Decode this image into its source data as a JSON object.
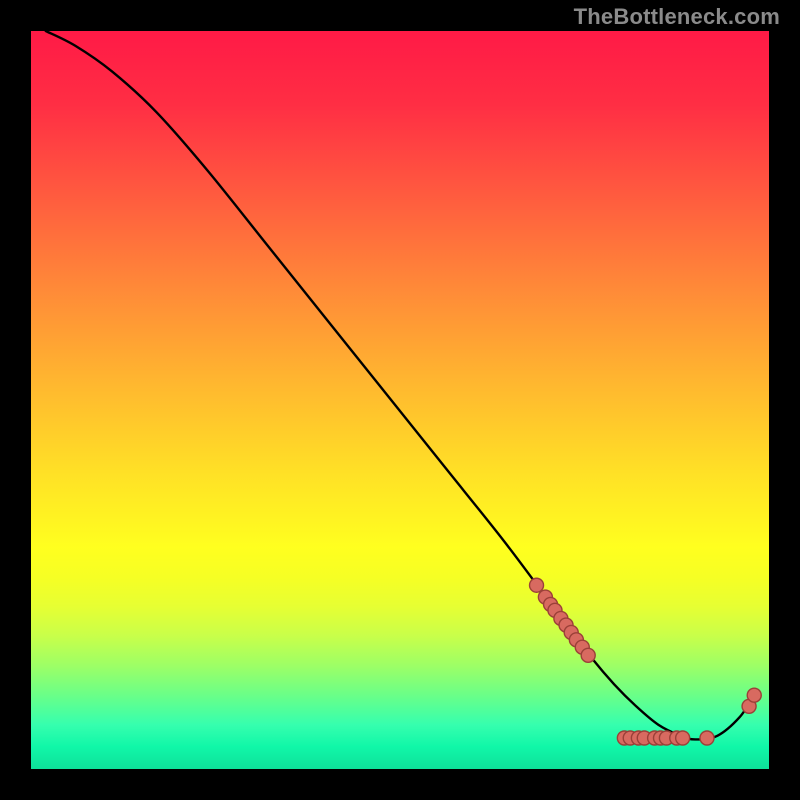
{
  "watermark": "TheBottleneck.com",
  "chart_data": {
    "type": "line",
    "title": "",
    "xlabel": "",
    "ylabel": "",
    "xlim": [
      0,
      100
    ],
    "ylim": [
      0,
      100
    ],
    "grid": false,
    "legend": false,
    "note": "Axes are implicit (no ticks shown). x is horizontal position 0–100, y is vertical value 0–100 with 0 at bottom.",
    "series": [
      {
        "name": "curve",
        "type": "line",
        "color": "#000000",
        "x": [
          2,
          6,
          11,
          17,
          24,
          32,
          40,
          48,
          56,
          64,
          70,
          73,
          76,
          79,
          82,
          85,
          88,
          90,
          93,
          96,
          98
        ],
        "y": [
          100,
          98,
          94.5,
          89,
          81,
          71,
          61,
          51,
          41,
          31,
          23,
          19,
          15,
          11.5,
          8.5,
          6,
          4.5,
          4,
          4.5,
          7,
          10
        ]
      },
      {
        "name": "upper-dot-cluster",
        "type": "scatter",
        "marker_color": "#d86a60",
        "marker_border": "#9b4038",
        "marker_radius_px": 7,
        "x": [
          68.5,
          69.7,
          70.4,
          71.0,
          71.8,
          72.5,
          73.2,
          73.9,
          74.7,
          75.5
        ],
        "y": [
          24.9,
          23.3,
          22.3,
          21.5,
          20.4,
          19.5,
          18.5,
          17.5,
          16.5,
          15.4
        ]
      },
      {
        "name": "bottom-dot-strip",
        "type": "scatter",
        "marker_color": "#d86a60",
        "marker_border": "#9b4038",
        "marker_radius_px": 7,
        "x": [
          80.4,
          81.2,
          82.3,
          83.1,
          84.5,
          85.3,
          86.1,
          87.5,
          88.3,
          91.6
        ],
        "y": [
          4.2,
          4.2,
          4.2,
          4.2,
          4.2,
          4.2,
          4.2,
          4.2,
          4.2,
          4.2
        ]
      },
      {
        "name": "rising-tail-dots",
        "type": "scatter",
        "marker_color": "#d86a60",
        "marker_border": "#9b4038",
        "marker_radius_px": 7,
        "x": [
          97.3,
          98.0
        ],
        "y": [
          8.5,
          10.0
        ]
      }
    ]
  }
}
